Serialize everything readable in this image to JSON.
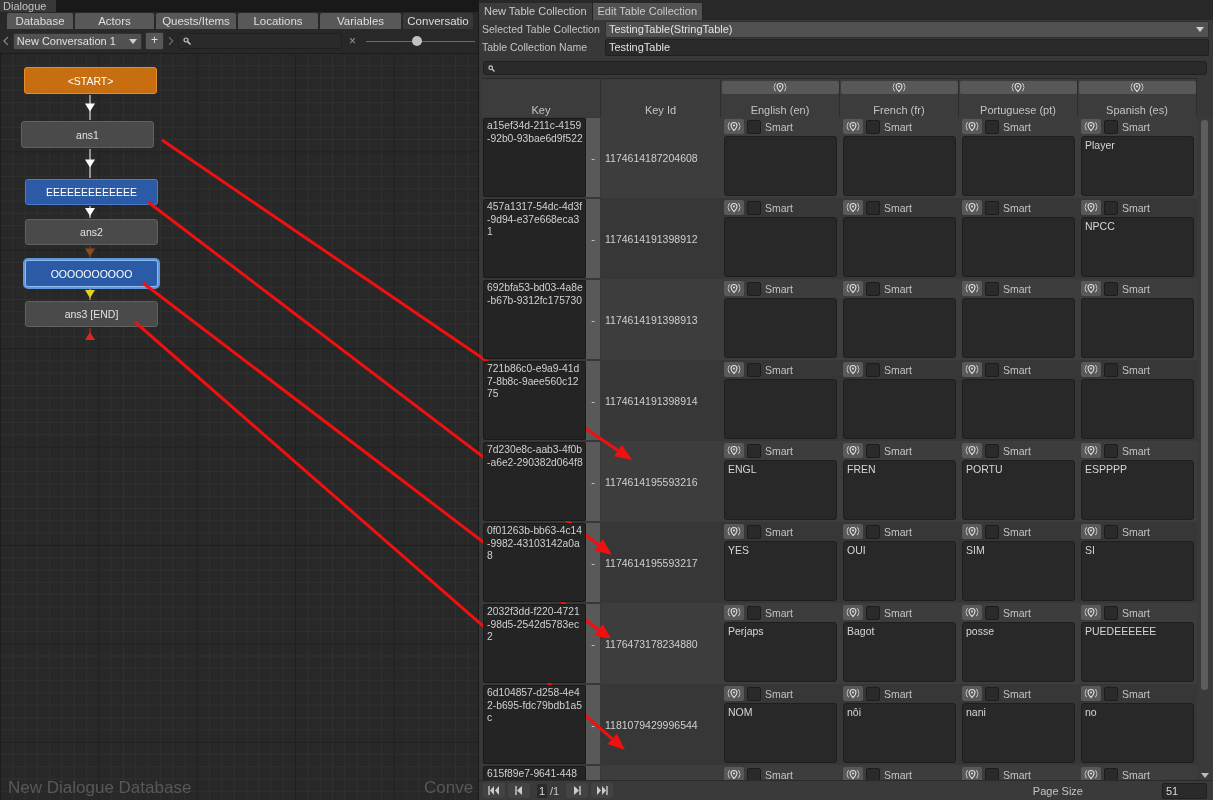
{
  "dialogue_window": {
    "title": "Dialogue",
    "tabs": [
      {
        "label": "Database",
        "selected": false
      },
      {
        "label": "Actors",
        "selected": false
      },
      {
        "label": "Quests/Items",
        "selected": false
      },
      {
        "label": "Locations",
        "selected": false
      },
      {
        "label": "Variables",
        "selected": false
      },
      {
        "label": "Conversatio",
        "selected": true
      }
    ],
    "toolbar": {
      "conversation": "New Conversation 1",
      "add_button": "+",
      "clear_search": "×",
      "zoom": {
        "level": 0.47
      }
    },
    "nodes": [
      {
        "label": "<START>",
        "kind": "start",
        "selected": false
      },
      {
        "label": "ans1",
        "kind": "response",
        "selected": false
      },
      {
        "label": "EEEEEEEEEEEEE",
        "kind": "npc",
        "selected": false
      },
      {
        "label": "ans2",
        "kind": "response",
        "selected": false
      },
      {
        "label": "OOOOOOOOOO",
        "kind": "npc",
        "selected": true
      },
      {
        "label": "ans3 [END]",
        "kind": "response",
        "selected": false
      }
    ],
    "canvas_labels": [
      "New Dialogue Database",
      "Conve"
    ]
  },
  "localization_window": {
    "tabs": [
      {
        "label": "New Table Collection",
        "selected": false
      },
      {
        "label": "Edit Table Collection",
        "selected": true
      }
    ],
    "selected_table_collection": {
      "label": "Selected Table Collection",
      "value": "TestingTable(StringTable)"
    },
    "table_collection_name": {
      "label": "Table Collection Name",
      "value": "TestingTable"
    },
    "table": {
      "key_header": "Key",
      "key_id_header": "Key Id",
      "language_headers": [
        "English (en)",
        "French (fr)",
        "Portuguese (pt)",
        "Spanish (es)"
      ],
      "rows": [
        {
          "key": "a15ef34d-211c-4159-92b0-93bae6d9f522",
          "remove": "-",
          "key_id": "1174614187204608",
          "cells": [
            {
              "smart": false,
              "label": "Smart"
            },
            {
              "smart": false,
              "label": "Smart"
            },
            {
              "smart": false,
              "label": "Smart"
            },
            {
              "smart": false,
              "label": "Smart",
              "value": "Player"
            }
          ]
        },
        {
          "key": "457a1317-54dc-4d3f-9d94-e37e668eca31",
          "remove": "-",
          "key_id": "1174614191398912",
          "cells": [
            {
              "smart": false,
              "label": "Smart"
            },
            {
              "smart": false,
              "label": "Smart"
            },
            {
              "smart": false,
              "label": "Smart"
            },
            {
              "smart": false,
              "label": "Smart",
              "value": "NPCC"
            }
          ]
        },
        {
          "key": "692bfa53-bd03-4a8e-b67b-9312fc175730",
          "remove": "-",
          "key_id": "1174614191398913",
          "cells": [
            {
              "smart": false,
              "label": "Smart"
            },
            {
              "smart": false,
              "label": "Smart"
            },
            {
              "smart": false,
              "label": "Smart"
            },
            {
              "smart": false,
              "label": "Smart"
            }
          ]
        },
        {
          "key": "721b86c0-e9a9-41d7-8b8c-9aee560c1275",
          "remove": "-",
          "key_id": "1174614191398914",
          "cells": [
            {
              "smart": false,
              "label": "Smart"
            },
            {
              "smart": false,
              "label": "Smart"
            },
            {
              "smart": false,
              "label": "Smart"
            },
            {
              "smart": false,
              "label": "Smart"
            }
          ]
        },
        {
          "key": "7d230e8c-aab3-4f0b-a6e2-290382d064f8",
          "remove": "-",
          "key_id": "1174614195593216",
          "cells": [
            {
              "smart": false,
              "label": "Smart",
              "value": "ENGL"
            },
            {
              "smart": false,
              "label": "Smart",
              "value": "FREN"
            },
            {
              "smart": false,
              "label": "Smart",
              "value": "PORTU"
            },
            {
              "smart": false,
              "label": "Smart",
              "value": "ESPPPP"
            }
          ]
        },
        {
          "key": "0f01263b-bb63-4c14-9982-43103142a0a8",
          "remove": "-",
          "key_id": "1174614195593217",
          "cells": [
            {
              "smart": false,
              "label": "Smart",
              "value": "YES"
            },
            {
              "smart": false,
              "label": "Smart",
              "value": "OUI"
            },
            {
              "smart": false,
              "label": "Smart",
              "value": "SIM"
            },
            {
              "smart": false,
              "label": "Smart",
              "value": "SI"
            }
          ]
        },
        {
          "key": "2032f3dd-f220-4721-98d5-2542d5783ec2",
          "remove": "-",
          "key_id": "1176473178234880",
          "cells": [
            {
              "smart": false,
              "label": "Smart",
              "value": "Perjaps"
            },
            {
              "smart": false,
              "label": "Smart",
              "value": "Bagot"
            },
            {
              "smart": false,
              "label": "Smart",
              "value": "posse"
            },
            {
              "smart": false,
              "label": "Smart",
              "value": "PUEDEEEEEE"
            }
          ]
        },
        {
          "key": "6d104857-d258-4e42-b695-fdc79bdb1a5c",
          "remove": "-",
          "key_id": "1181079429996544",
          "cells": [
            {
              "smart": false,
              "label": "Smart",
              "value": "NOM"
            },
            {
              "smart": false,
              "label": "Smart",
              "value": "nôi"
            },
            {
              "smart": false,
              "label": "Smart",
              "value": "nani"
            },
            {
              "smart": false,
              "label": "Smart",
              "value": "no"
            }
          ]
        },
        {
          "key": "615f89e7-9641-448",
          "cells": [
            {
              "smart": false,
              "label": "Smart"
            },
            {
              "smart": false,
              "label": "Smart"
            },
            {
              "smart": false,
              "label": "Smart"
            },
            {
              "smart": false,
              "label": "Smart"
            }
          ]
        }
      ]
    },
    "footer": {
      "page": "1",
      "page_count": "/1",
      "page_size_label": "Page Size",
      "page_size": "51"
    }
  }
}
